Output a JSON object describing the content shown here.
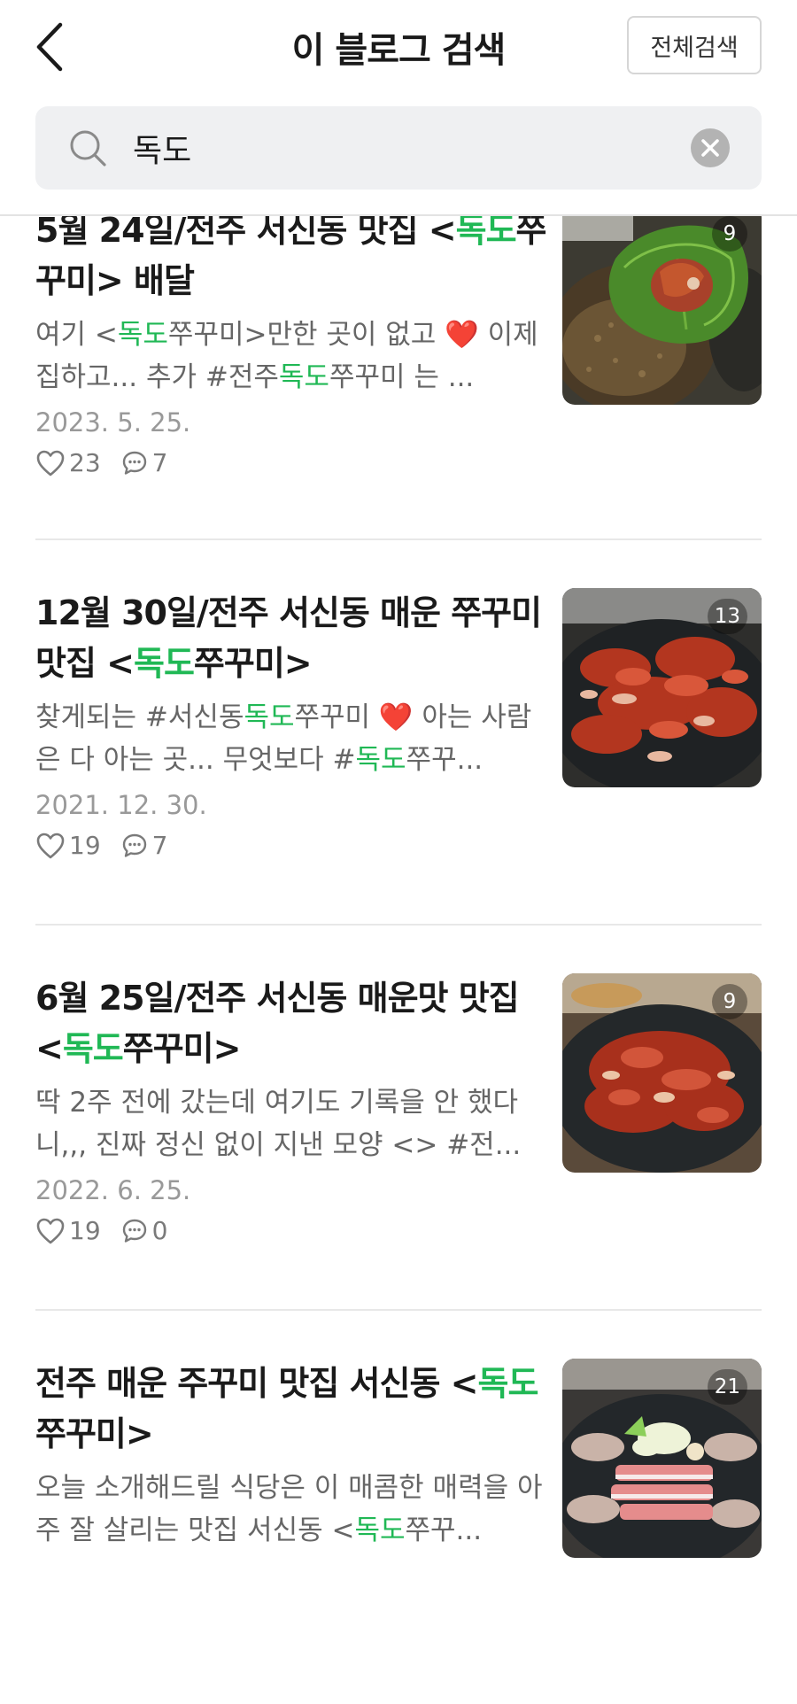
{
  "header": {
    "title": "이 블로그 검색",
    "global_search_label": "전체검색"
  },
  "search": {
    "query": "독도",
    "placeholder": ""
  },
  "colors": {
    "highlight": "#20b855",
    "search_bg": "#eff0f2"
  },
  "results": [
    {
      "title": [
        {
          "t": "5월 24일/전주 서신동 맛집 <"
        },
        {
          "t": "독도",
          "hl": true
        },
        {
          "t": "쭈꾸미> 배달"
        }
      ],
      "snippet": [
        {
          "t": "여기 <"
        },
        {
          "t": "독도",
          "hl": true
        },
        {
          "t": "쭈꾸미>만한 곳이 없고 ❤️ 이제 집하고... 추가 #전주"
        },
        {
          "t": "독도",
          "hl": true
        },
        {
          "t": "쭈꾸미 는 ..."
        }
      ],
      "date": "2023. 5. 25.",
      "likes": "23",
      "comments": "7",
      "photo_count": "9"
    },
    {
      "title": [
        {
          "t": "12월 30일/전주 서신동 매운 쭈꾸미 맛집 <"
        },
        {
          "t": "독도",
          "hl": true
        },
        {
          "t": "쭈꾸미>"
        }
      ],
      "snippet": [
        {
          "t": "찾게되는 #서신동"
        },
        {
          "t": "독도",
          "hl": true
        },
        {
          "t": "쭈꾸미 ❤️ 아는 사람은 다 아는 곳... 무엇보다 #"
        },
        {
          "t": "독도",
          "hl": true
        },
        {
          "t": "쭈꾸..."
        }
      ],
      "date": "2021. 12. 30.",
      "likes": "19",
      "comments": "7",
      "photo_count": "13"
    },
    {
      "title": [
        {
          "t": "6월 25일/전주 서신동 매운맛 맛집 <"
        },
        {
          "t": "독도",
          "hl": true
        },
        {
          "t": "쭈꾸미>"
        }
      ],
      "snippet": [
        {
          "t": "딱 2주 전에 갔는데 여기도 기록을 안 했다니,,, 진짜 정신 없이 지낸 모양 <> #전..."
        }
      ],
      "date": "2022. 6. 25.",
      "likes": "19",
      "comments": "0",
      "photo_count": "9"
    },
    {
      "title": [
        {
          "t": "전주 매운 주꾸미 맛집 서신동 <"
        },
        {
          "t": "독도",
          "hl": true
        },
        {
          "t": "쭈꾸미>"
        }
      ],
      "snippet": [
        {
          "t": "오늘 소개해드릴 식당은 이 매콤한 매력을 아주 잘 살리는 맛집 서신동 <"
        },
        {
          "t": "독도",
          "hl": true
        },
        {
          "t": "쭈꾸..."
        }
      ],
      "date": "",
      "likes": "",
      "comments": "",
      "photo_count": "21"
    }
  ]
}
